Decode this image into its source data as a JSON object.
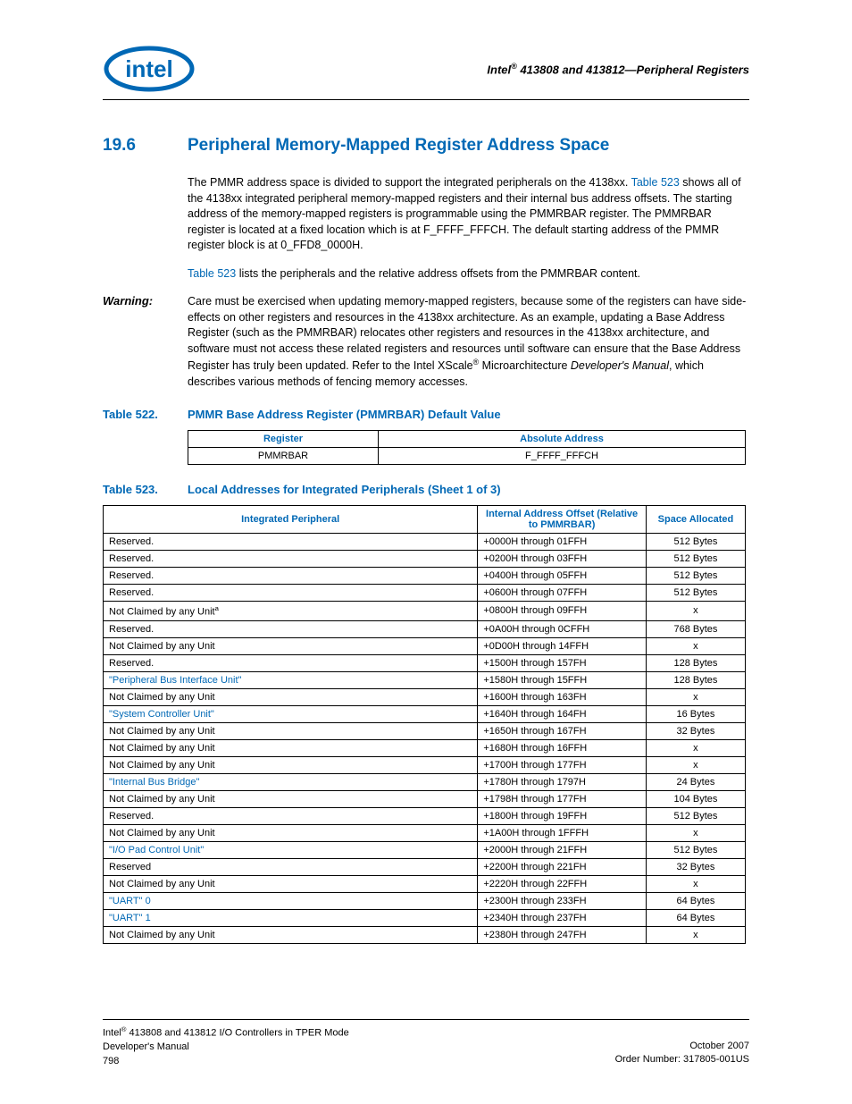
{
  "header": {
    "doc_title_1": "Intel",
    "doc_title_2": " 413808 and 413812—Peripheral Registers"
  },
  "section": {
    "number": "19.6",
    "title": "Peripheral Memory-Mapped Register Address Space"
  },
  "para1a": "The PMMR address space is divided to support the integrated peripherals on the 4138xx. ",
  "para1_link": "Table 523",
  "para1b": " shows all of the 4138xx integrated peripheral memory-mapped registers and their internal bus address offsets. The starting address of the memory-mapped registers is programmable using the PMMRBAR register. The PMMRBAR register is located at a fixed location which is at F_FFFF_FFFCH. The default starting address of the PMMR register block is at 0_FFD8_0000H.",
  "para2_link": "Table 523",
  "para2b": " lists the peripherals and the relative address offsets from the PMMRBAR content.",
  "warning_label": "Warning:",
  "warning_a": "Care must be exercised when updating memory-mapped registers, because some of the registers can have side-effects on other registers and resources in the 4138xx architecture. As an example, updating a Base Address Register (such as the PMMRBAR) relocates other registers and resources in the 4138xx architecture, and software must not access these related registers and resources until software can ensure that the Base Address Register has truly been updated. Refer to the Intel XScale",
  "warning_b": " Microarchitecture ",
  "warning_ital": "Developer's Manual",
  "warning_c": ", which describes various methods of fencing memory accesses.",
  "t522": {
    "label": "Table 522.",
    "caption": "PMMR Base Address Register (PMMRBAR) Default Value",
    "headers": [
      "Register",
      "Absolute Address"
    ],
    "row": [
      "PMMRBAR",
      "F_FFFF_FFFCH"
    ]
  },
  "t523": {
    "label": "Table 523.",
    "caption": "Local Addresses for Integrated Peripherals (Sheet 1 of 3)",
    "headers": [
      "Integrated Peripheral",
      "Internal Address Offset (Relative to PMMRBAR)",
      "Space Allocated"
    ],
    "rows": [
      {
        "p": "Reserved.",
        "link": false,
        "sup": "",
        "a": "+0000H through 01FFH",
        "s": "512 Bytes"
      },
      {
        "p": "Reserved.",
        "link": false,
        "sup": "",
        "a": "+0200H through 03FFH",
        "s": "512 Bytes"
      },
      {
        "p": "Reserved.",
        "link": false,
        "sup": "",
        "a": "+0400H through 05FFH",
        "s": "512 Bytes"
      },
      {
        "p": "Reserved.",
        "link": false,
        "sup": "",
        "a": "+0600H through 07FFH",
        "s": "512 Bytes"
      },
      {
        "p": "Not Claimed by any Unit",
        "link": false,
        "sup": "a",
        "a": "+0800H through 09FFH",
        "s": "x"
      },
      {
        "p": "Reserved.",
        "link": false,
        "sup": "",
        "a": "+0A00H through 0CFFH",
        "s": "768 Bytes"
      },
      {
        "p": "Not Claimed by any Unit",
        "link": false,
        "sup": "",
        "a": "+0D00H through 14FFH",
        "s": "x"
      },
      {
        "p": "Reserved.",
        "link": false,
        "sup": "",
        "a": "+1500H through 157FH",
        "s": "128 Bytes"
      },
      {
        "p": "\"Peripheral Bus Interface Unit\"",
        "link": true,
        "sup": "",
        "a": "+1580H through 15FFH",
        "s": "128 Bytes"
      },
      {
        "p": "Not Claimed by any Unit",
        "link": false,
        "sup": "",
        "a": "+1600H through 163FH",
        "s": "x"
      },
      {
        "p": "\"System Controller Unit\"",
        "link": true,
        "sup": "",
        "a": "+1640H through 164FH",
        "s": "16 Bytes"
      },
      {
        "p": "Not Claimed by any Unit",
        "link": false,
        "sup": "",
        "a": "+1650H through 167FH",
        "s": "32 Bytes"
      },
      {
        "p": "Not Claimed by any Unit",
        "link": false,
        "sup": "",
        "a": "+1680H through 16FFH",
        "s": "x"
      },
      {
        "p": "Not Claimed by any Unit",
        "link": false,
        "sup": "",
        "a": "+1700H through 177FH",
        "s": "x"
      },
      {
        "p": "\"Internal Bus Bridge\"",
        "link": true,
        "sup": "",
        "a": "+1780H through 1797H",
        "s": "24 Bytes"
      },
      {
        "p": "Not Claimed by any Unit",
        "link": false,
        "sup": "",
        "a": "+1798H through 177FH",
        "s": "104 Bytes"
      },
      {
        "p": "Reserved.",
        "link": false,
        "sup": "",
        "a": "+1800H through 19FFH",
        "s": "512 Bytes"
      },
      {
        "p": "Not Claimed by any Unit",
        "link": false,
        "sup": "",
        "a": "+1A00H through 1FFFH",
        "s": "x"
      },
      {
        "p": "\"I/O Pad Control Unit\"",
        "link": true,
        "sup": "",
        "a": "+2000H through 21FFH",
        "s": "512 Bytes"
      },
      {
        "p": "Reserved",
        "link": false,
        "sup": "",
        "a": "+2200H through 221FH",
        "s": "32 Bytes"
      },
      {
        "p": "Not Claimed by any Unit",
        "link": false,
        "sup": "",
        "a": "+2220H through 22FFH",
        "s": "x"
      },
      {
        "p": "\"UART\" 0",
        "link": true,
        "sup": "",
        "a": "+2300H through 233FH",
        "s": "64 Bytes"
      },
      {
        "p": "\"UART\" 1",
        "link": true,
        "sup": "",
        "a": "+2340H through 237FH",
        "s": "64 Bytes"
      },
      {
        "p": "Not Claimed by any Unit",
        "link": false,
        "sup": "",
        "a": "+2380H through 247FH",
        "s": "x"
      }
    ]
  },
  "footer": {
    "left1_a": "Intel",
    "left1_b": " 413808 and 413812 I/O Controllers in TPER Mode",
    "left2": "Developer's Manual",
    "left3": "798",
    "right1": "October 2007",
    "right2": "Order Number: 317805-001US"
  }
}
